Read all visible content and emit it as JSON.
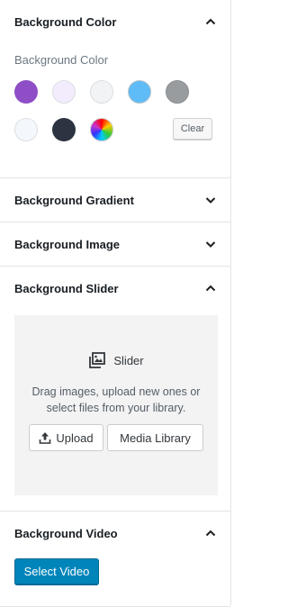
{
  "sections": {
    "color": {
      "title": "Background Color",
      "expanded": true,
      "control_label": "Background Color",
      "swatches": [
        {
          "name": "purple",
          "color": "#8e4ec6"
        },
        {
          "name": "lavender",
          "color": "#f3ecfc"
        },
        {
          "name": "light-gray",
          "color": "#f1f3f4"
        },
        {
          "name": "sky-blue",
          "color": "#5fbcf6"
        },
        {
          "name": "gray",
          "color": "#999c9f"
        },
        {
          "name": "off-white",
          "color": "#f4f8fc"
        },
        {
          "name": "navy",
          "color": "#2c3442"
        },
        {
          "name": "custom-gradient",
          "color": "conic"
        }
      ],
      "clear_label": "Clear"
    },
    "gradient": {
      "title": "Background Gradient",
      "expanded": false
    },
    "image": {
      "title": "Background Image",
      "expanded": false
    },
    "slider": {
      "title": "Background Slider",
      "expanded": true,
      "placeholder_title": "Slider",
      "help_text": "Drag images, upload new ones or select files from your library.",
      "upload_label": "Upload",
      "library_label": "Media Library"
    },
    "video": {
      "title": "Background Video",
      "expanded": true,
      "select_label": "Select Video"
    }
  },
  "colors": {
    "primary_button": "#0085ba",
    "border": "#e2e4e7",
    "placeholder_bg": "#f3f3f3"
  }
}
